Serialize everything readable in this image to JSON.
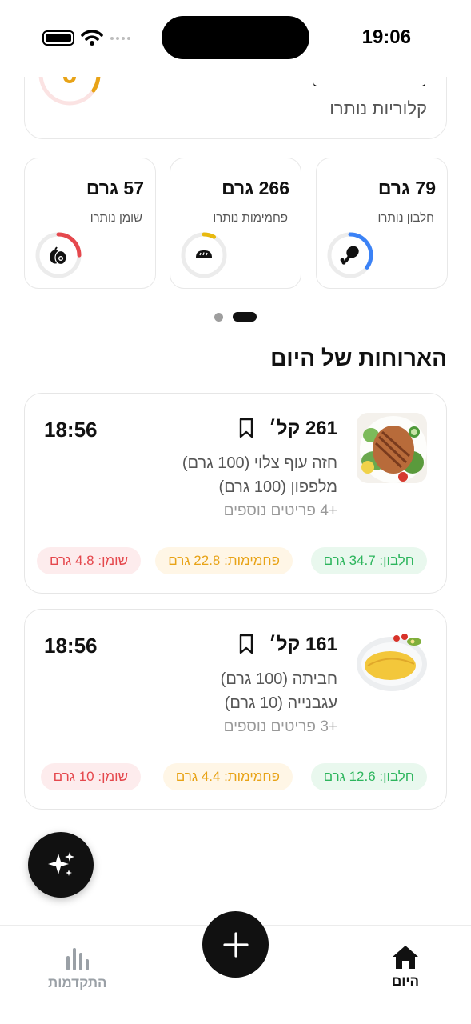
{
  "status_bar": {
    "time": "19:06"
  },
  "summary": {
    "calories_label": "קלוריות נותרו",
    "ring_color": "#e8a317",
    "icon": "flame-icon"
  },
  "macros": [
    {
      "value": "79 גרם",
      "label": "חלבון נותרו",
      "icon": "drumstick-icon",
      "color": "#3b82f6",
      "progress": 0.35
    },
    {
      "value": "266 גרם",
      "label": "פחמימות נותרו",
      "icon": "bread-icon",
      "color": "#e8b90f",
      "progress": 0.08
    },
    {
      "value": "57 גרם",
      "label": "שומן נותרו",
      "icon": "avocado-icon",
      "color": "#e5484d",
      "progress": 0.25
    }
  ],
  "pager": {
    "pages": 2,
    "active": 2
  },
  "meals_section": {
    "title": "הארוחות של היום"
  },
  "meals": [
    {
      "calories": "261 קל׳",
      "time": "18:56",
      "items": [
        "חזה עוף צלוי (100 גרם)",
        "מלפפון (100 גרם)"
      ],
      "more": "+4 פריטים נוספים",
      "protein": "חלבון: 34.7 גרם",
      "carbs": "פחמימות: 22.8 גרם",
      "fat": "שומן: 4.8 גרם",
      "image": "grilled-chicken-salad"
    },
    {
      "calories": "161 קל׳",
      "time": "18:56",
      "items": [
        "חביתה (100 גרם)",
        "עגבנייה (10 גרם)"
      ],
      "more": "+3 פריטים נוספים",
      "protein": "חלבון: 12.6 גרם",
      "carbs": "פחמימות: 4.4 גרם",
      "fat": "שומן: 10 גרם",
      "image": "omelette-plate"
    }
  ],
  "bottom_nav": {
    "today_label": "היום",
    "progress_label": "התקדמות"
  },
  "colors": {
    "accent": "#111111",
    "protein": "#2db55d",
    "carbs": "#e8a317",
    "fat": "#e5484d"
  }
}
